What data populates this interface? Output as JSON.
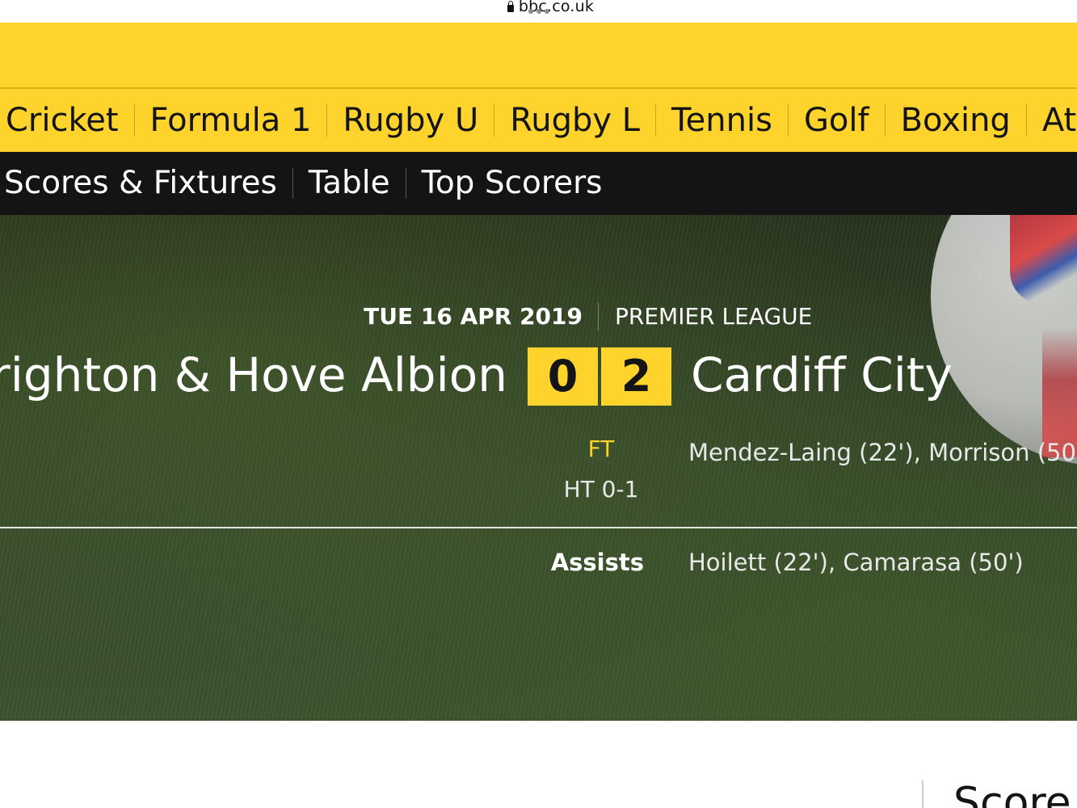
{
  "browser": {
    "url": "bbc.co.uk"
  },
  "sport_nav": {
    "items": [
      "Cricket",
      "Formula 1",
      "Rugby U",
      "Rugby L",
      "Tennis",
      "Golf",
      "Boxing",
      "Athlet"
    ]
  },
  "sub_nav": {
    "items": [
      "Scores & Fixtures",
      "Table",
      "Top Scorers"
    ]
  },
  "match": {
    "date": "TUE 16 APR 2019",
    "competition": "PREMIER LEAGUE",
    "home_team": "Brighton & Hove Albion",
    "away_team": "Cardiff City",
    "home_score": "0",
    "away_score": "2",
    "status": "FT",
    "half_time": "HT 0-1",
    "away_scorers": "Mendez-Laing (22'), Morrison (50",
    "assists_label": "Assists",
    "away_assists": "Hoilett (22'), Camarasa (50')"
  },
  "below": {
    "heading": "Score"
  },
  "colors": {
    "bbc_yellow": "#fed42c",
    "nav_black": "#141414"
  }
}
